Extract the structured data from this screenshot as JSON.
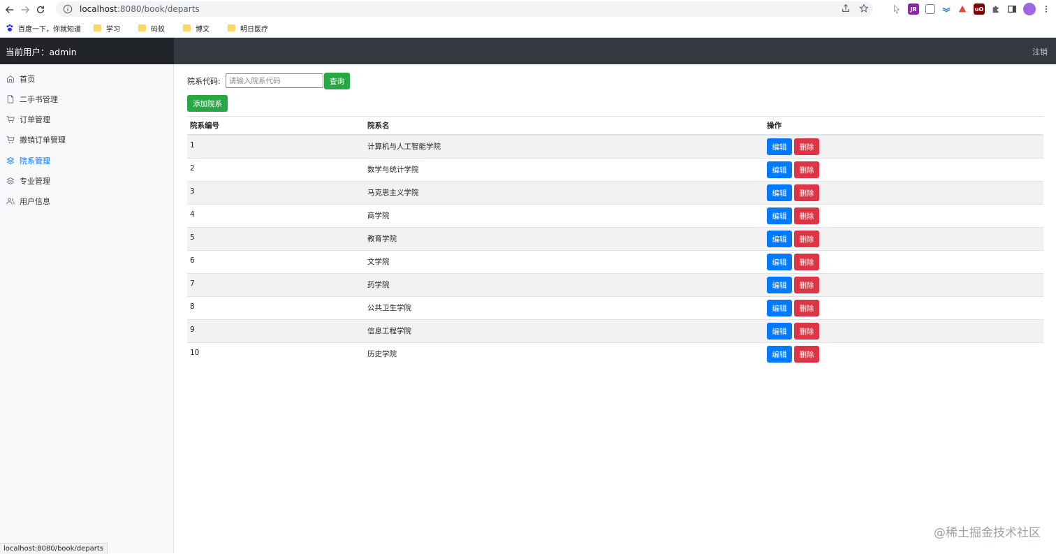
{
  "browser": {
    "url_host": "localhost",
    "url_rest": ":8080/book/departs",
    "bookmarks": [
      {
        "label": "百度一下，你就知道",
        "icon": "baidu-paw-icon"
      },
      {
        "label": "学习",
        "icon": "folder-icon"
      },
      {
        "label": "码蚁",
        "icon": "folder-icon"
      },
      {
        "label": "博文",
        "icon": "folder-icon"
      },
      {
        "label": "明日医疗",
        "icon": "folder-icon"
      }
    ],
    "status_url": "localhost:8080/book/departs"
  },
  "header": {
    "current_user": "当前用户：admin",
    "logout": "注销"
  },
  "sidebar": {
    "items": [
      {
        "label": "首页",
        "icon": "home-icon",
        "active": false
      },
      {
        "label": "二手书管理",
        "icon": "file-icon",
        "active": false
      },
      {
        "label": "订单管理",
        "icon": "cart-icon",
        "active": false
      },
      {
        "label": "撤销订单管理",
        "icon": "cart-icon",
        "active": false
      },
      {
        "label": "院系管理",
        "icon": "layers-icon",
        "active": true
      },
      {
        "label": "专业管理",
        "icon": "layers-icon",
        "active": false
      },
      {
        "label": "用户信息",
        "icon": "users-icon",
        "active": false
      }
    ]
  },
  "search": {
    "label": "院系代码:",
    "placeholder": "请输入院系代码",
    "value": "",
    "button": "查询"
  },
  "add_button": "添加院系",
  "table": {
    "headers": [
      "院系编号",
      "院系名",
      "操作"
    ],
    "rows": [
      {
        "id": "1",
        "name": "计算机与人工智能学院"
      },
      {
        "id": "2",
        "name": "数学与统计学院"
      },
      {
        "id": "3",
        "name": "马克思主义学院"
      },
      {
        "id": "4",
        "name": "商学院"
      },
      {
        "id": "5",
        "name": "教育学院"
      },
      {
        "id": "6",
        "name": "文学院"
      },
      {
        "id": "7",
        "name": "药学院"
      },
      {
        "id": "8",
        "name": "公共卫生学院"
      },
      {
        "id": "9",
        "name": "信息工程学院"
      },
      {
        "id": "10",
        "name": "历史学院"
      }
    ],
    "edit_label": "编辑",
    "delete_label": "删除"
  },
  "watermark": "@稀土掘金技术社区",
  "colors": {
    "header_bg": "#343a40",
    "brand_bg": "#212529",
    "primary": "#007bff",
    "success": "#28a745",
    "danger": "#dc3545"
  }
}
